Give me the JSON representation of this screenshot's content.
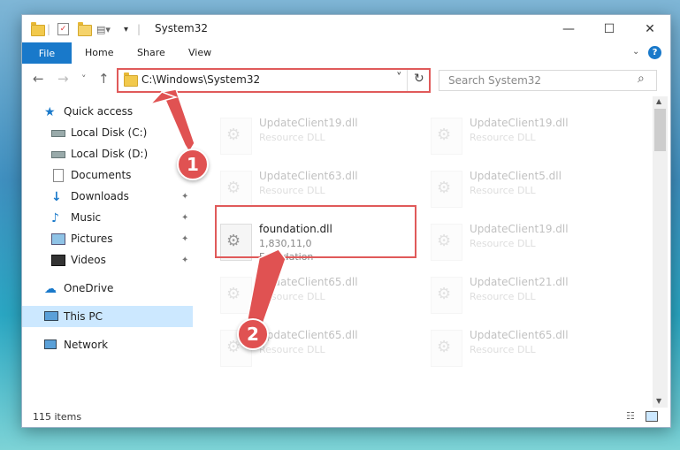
{
  "window": {
    "title": "System32"
  },
  "titlebar": {
    "minimize": "—",
    "maximize": "☐",
    "close": "✕"
  },
  "ribbon": {
    "file": "File",
    "tabs": [
      "Home",
      "Share",
      "View"
    ],
    "help": "?"
  },
  "navbar": {
    "back": "←",
    "forward": "→",
    "recent": "˅",
    "up": "↑",
    "address": "C:\\Windows\\System32",
    "dropdown": "˅",
    "refresh": "↻",
    "search_placeholder": "Search System32",
    "search_icon": "⌕"
  },
  "sidebar": {
    "items": [
      {
        "label": "Quick access",
        "icon": "star-icon"
      },
      {
        "label": "Local Disk (C:)",
        "icon": "drive-icon"
      },
      {
        "label": "Local Disk (D:)",
        "icon": "drive-icon"
      },
      {
        "label": "Documents",
        "icon": "documents-icon"
      },
      {
        "label": "Downloads",
        "icon": "downloads-icon",
        "pinned": true
      },
      {
        "label": "Music",
        "icon": "music-icon",
        "pinned": true
      },
      {
        "label": "Pictures",
        "icon": "pictures-icon",
        "pinned": true
      },
      {
        "label": "Videos",
        "icon": "videos-icon",
        "pinned": true
      },
      {
        "label": "OneDrive",
        "icon": "onedrive-icon"
      },
      {
        "label": "This PC",
        "icon": "this-pc-icon",
        "selected": true
      },
      {
        "label": "Network",
        "icon": "network-icon"
      }
    ],
    "pin_glyph": "📌"
  },
  "files": [
    {
      "name": "UpdateClient19.dll",
      "type": "Resource DLL"
    },
    {
      "name": "UpdateClient19.dll",
      "type": "Resource DLL"
    },
    {
      "name": "UpdateClient63.dll",
      "type": "Resource DLL"
    },
    {
      "name": "UpdateClient5.dll",
      "type": "Resource DLL"
    },
    {
      "name": "foundation.dll",
      "version": "1,830,11,0",
      "type": "Foundation"
    },
    {
      "name": "UpdateClient19.dll",
      "type": "Resource DLL"
    },
    {
      "name": "UpdateClient65.dll",
      "type": "Resource DLL"
    },
    {
      "name": "UpdateClient21.dll",
      "type": "Resource DLL"
    },
    {
      "name": "UpdateClient65.dll",
      "type": "Resource DLL"
    },
    {
      "name": "UpdateClient65.dll",
      "type": "Resource DLL"
    }
  ],
  "status": {
    "count": "115 items"
  },
  "annotations": [
    {
      "label": "1"
    },
    {
      "label": "2"
    }
  ],
  "colors": {
    "accent": "#1979ca",
    "highlight": "#e05a5a",
    "selection": "#cce8ff"
  }
}
